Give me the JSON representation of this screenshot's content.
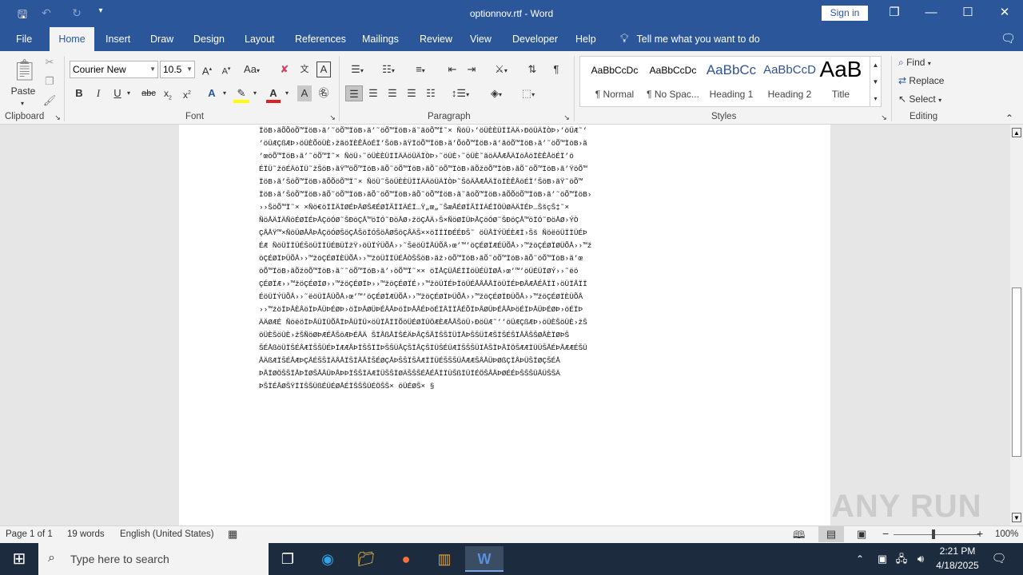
{
  "app": {
    "title": "optionnov.rtf - Word",
    "sign_in": "Sign in"
  },
  "tabs": [
    "File",
    "Home",
    "Insert",
    "Draw",
    "Design",
    "Layout",
    "References",
    "Mailings",
    "Review",
    "View",
    "Developer",
    "Help"
  ],
  "tell_me": "Tell me what you want to do",
  "clipboard": {
    "paste": "Paste",
    "label": "Clipboard"
  },
  "font": {
    "name": "Courier New",
    "size": "10.5",
    "label": "Font",
    "case_label": "Aa"
  },
  "paragraph": {
    "label": "Paragraph"
  },
  "styles": {
    "label": "Styles",
    "items": [
      {
        "preview": "AaBbCcDc",
        "name": "¶ Normal"
      },
      {
        "preview": "AaBbCcDc",
        "name": "¶ No Spac..."
      },
      {
        "preview": "AaBbCc",
        "name": "Heading 1"
      },
      {
        "preview": "AaBbCcD",
        "name": "Heading 2"
      },
      {
        "preview": "AaB",
        "name": "Title"
      }
    ]
  },
  "editing": {
    "label": "Editing",
    "find": "Find",
    "replace": "Replace",
    "select": "Select"
  },
  "document": {
    "text": "ÏöB›ãÕÕöÕ™ÏöB›ã’˜öÕ™ÏöB›ã’˜öÕ™ÏöB›ã˜ãöÕ™Ï˜× ÑöÜ›’öÜÈÈÜÏÏÄÄ›ÐöÜÄÏÒÞ›’öÜÆ˜’\n’öÜÆÇßÆÞ›öÜÈÕöÜÈ›žãöÏÈÊÅöÉÏ’ŠöB›ãŸÏöÕ™ÏöB›ã’ÕöÕ™ÏöB›ã’ãöÕ™ÏöB›ã’˜öÕ™ÏöB›ã\n’œöÕ™ÏöB›ã’˜öÕ™Ï˜× ÑöÜ›˜öÜÈÈÜÏÏÄÄöÜÄÏÒÞ›˜öÜÈ›˜öÜÈ˜ãöÄÅÆÅÄÏöÅöÏÈÊÅöÉÏ’ö\nÉÏÜ˜žöÉÄöÏÜ˜žŠöB›ãŸ™öÕ™ÏöB›ãÕ˜öÕ™ÏöB›ãÕ˜öÕ™ÏöB›ãÕžöÕ™ÏöB›ãÕ˜öÕ™ÏöB›ã’ŸöÕ™\nÏöB›ã’ŠöÕ™ÏöB›ãÕÕöÕ™Ï˜× ÑöÜ˜ŠöÜÈÈÜÏÏÄÄöÜÄÏÒÞ˜ŠöÄÅÆÅÄÏöÏÈÊÅöÉÏ’ŠöB›ãŸ˜öÕ™\nÏöB›ã’ŠöÕ™ÏöB›ãÕ˜öÕ™ÏöB›ãÕ˜öÕ™ÏöB›ãÕ˜öÕ™ÏöB›ã˜ãöÕ™ÏöB›ãÕÕöÕ™ÏöB›ã’˜öÕ™ÏöB›\n››ŠöÕ™Ï˜× ×Ñö€öÏÏÄÏØÉÞÅØŠÆÉØÏÃÏÏÄÉÏ…Ÿ„œ„˜ŠæÅÉØÏÃÏÏÄÉÏÖÜØÄÄÏÉÞ…ŠšçŠ‡˜×\nÑöÅÄÏÄÑöÉØÏÉÞÅÇöÓØ˜ŠÐöÇÅ™öÏÓ˜ÐöÅØ›žöÇÅÄ›Š×ÑöØÏÜÞÅÇöÓØ˜ŠÐöÇÅ™öÏÓ˜ÐöÅØ›ÝÒ\nÇÅÅŸ™×ÑöÜØÅÅÞÅÇöÓØŠöÇÅŠöÏÓŠöÅØŠöÇÅÄŠ××öÏÏÏÐÉÉÐŠ˜ öÜÅÏÝÜÉÈÆÏ›Šš ÑöëöÜÏÏÜÉÞ\nÉÆ ÑöÜÏÏÜÉŠöÜÏÏÜÉBÜÏžŸ›öÜÏÝÜÕÅ››˜ŠëöÜÏÅÜÕÅ›œ’™’öÇÉØÏÆÉÜÕÅ››™žöÇÉØÏØÜÕÅ››™ž\nöÇÉØÏÞÜÕÅ››™žöÇÉØÏÈÜÕÅ››™žöÜÏÏÜÉÅÒŠŠöB›ãž›öÕ™ÏöB›ãÕ˜öÕ™ÏöB›ãÕ˜öÕ™ÏöB›ã’œ\nöÕ™ÏöB›ãÕžöÕ™ÏöB›ã˜˜öÕ™ÏöB›ã’›öÕ™Ï˜×× öÏÅÇÜÅÉÏÏöÜÉÜÏØÅ›œ’™’öÜÉÜÏØÝ››˜ëö\nÇÉØÏÆ››™žöÇÉØÏØ››™žöÇÉØÏÞ››™žöÇÉØÏÉ››™žöÜÏÉÞÏöÜÉÅÅÅÅÏöÜÏÉÞÐÅÆÅÉÅÏÏ›öÜÏÅÏÏ\nÉöÜÏÝÜÕÅ››˜ëöÜÏÅÜÕÅ›œ’™’öÇÉØÏÆÜÕÅ››™žöÇÉØÏÞÜÕÅ››™žöÇÉØÏÐÜÕÅ››™žöÇÉØÏÈÜÕÅ\n››™žöÏÞÅÈÅöÏÞÅÜÞÉØÞ›öÏÞÅØÜÞÉÅÅÞöÏÞÅÅÉÞöÉÏÅÏÏÅÉÕÏÞÅØÜÞÉÅÅÞöÉÏÞÅÜÞÉØÞ›öÉÏÞ\nÄÄØÆÉ ÑöëöÏÞÅÜÏÜÕÅÏÞÅÜÏÜ×öÜÏÅÏÏÕöÜÉØÏÜÖÆÈÆÅÅŠöÜ›ÐöÜÆ˜’’öÜÆÇßÆÞ›öÜÈŠöÜÈ›žŠ\nöÜÈŠöÜÈ›žŠÑöØÞÆÉÅŠöÆÞÉÅÄ ŠÏÅßÅÏŠÉÄÞÅÇŠÅÏŠŠÏÜÏÅÞŠŠÜÏÆŠÏŠÉŠÏÅÅŠŠØÅÈÏØÞŠ\nŠÉÅßöÜÏŠÉÅÆÏŠŠÜÉÞÏÆÆÅÞÏŠŠÏÏÞŠŠÜÅÇŠÏÅÇŠÏÜŠÉÜÆÏŠŠŠÜÏÅŠÏÞÅÏÖŠÆÆÏÜÜŠÅÉÞÅÆÆÉŠÜ\nÅÄßÆÏŠÉÅÆÞÇÅÉŠŠÏÄÅÅÏŠÏÅÅÏŠÉØÇÅÞŠŠÏŠÅÆÏÏÜÉŠŠŠÜÅÆÆŠÅÅÜÞØßÇÏÅÞÜŠÏØÇŠÉÅ\nÞÅÏØÖŠŠÏÅÞÏØŠÅÅÜÞÅÞÞÏŠŠÏÄÆÏÜŠŠÏØÄŠŠŠÉÅÉÅÏÏÜŠßÏÜÏÉÖŠÅÅÞØÉÉÞŠŠŠÜÅÜŠŠÄ\nÞŠÏÉÅØŠŸÏÏŠŠÜßÉÜÉØÅÉÏŠŠŠÜÉÖŠŠ× öÜÉØŠ× §"
  },
  "status": {
    "page": "Page 1 of 1",
    "words": "19 words",
    "language": "English (United States)",
    "zoom": "100%"
  },
  "taskbar": {
    "search_placeholder": "Type here to search",
    "time": "2:21 PM",
    "date": "4/18/2025"
  },
  "watermark": "ANY RUN",
  "colors": {
    "accent": "#2b579a",
    "taskbar": "#1c2b3d"
  }
}
